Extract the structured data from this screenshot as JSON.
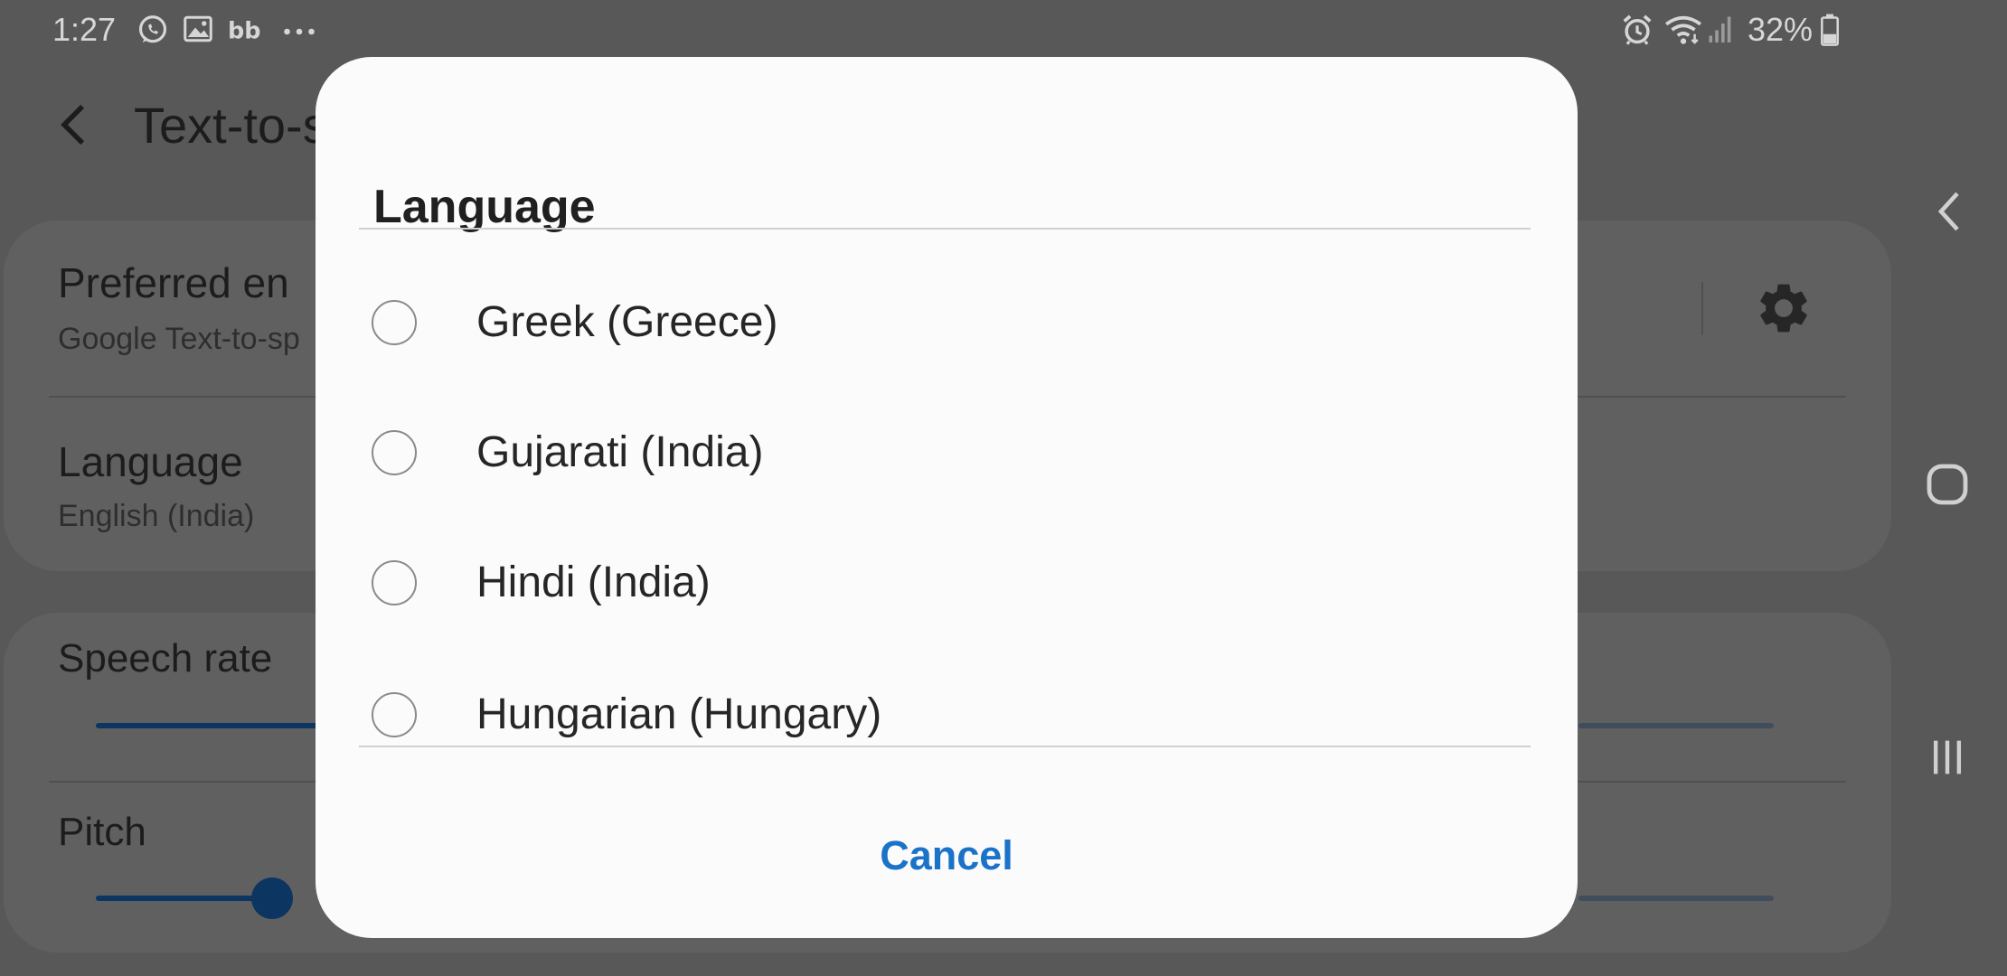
{
  "status_bar": {
    "time": "1:27",
    "notification_icons": [
      "whatsapp-icon",
      "gallery-icon",
      "bb-app-icon",
      "more-dots-icon"
    ],
    "system_icons": [
      "alarm-icon",
      "wifi-icon",
      "signal-icon",
      "battery-icon"
    ],
    "battery": "32%"
  },
  "background_screen": {
    "title": "Text-to-s",
    "preferred_engine": {
      "title": "Preferred en",
      "subtitle": "Google Text-to-sp"
    },
    "language": {
      "title": "Language",
      "subtitle": "English (India)"
    },
    "speech_rate": {
      "label": "Speech rate"
    },
    "pitch": {
      "label": "Pitch"
    }
  },
  "dialog": {
    "title": "Language",
    "options": [
      {
        "label": "Greek (Greece)",
        "selected": false
      },
      {
        "label": "Gujarati (India)",
        "selected": false
      },
      {
        "label": "Hindi (India)",
        "selected": false
      },
      {
        "label": "Hungarian (Hungary)",
        "selected": false
      }
    ],
    "cancel_label": "Cancel"
  },
  "colors": {
    "accent": "#1a73c8",
    "scrim": "#585858",
    "dialog_bg": "#fbfbfb",
    "slider_active": "#0c3561"
  }
}
